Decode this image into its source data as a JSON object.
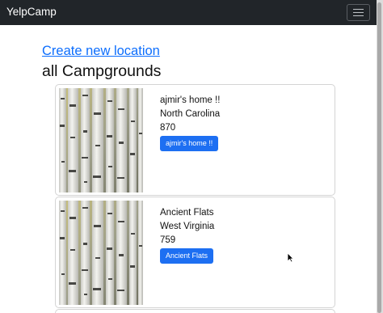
{
  "navbar": {
    "brand": "YelpCamp",
    "menu_icon": "hamburger-icon"
  },
  "main": {
    "create_link": "Create new location",
    "title": "all Campgrounds",
    "campgrounds": [
      {
        "name": "ajmir's home !!",
        "location": "North Carolina",
        "price": "870",
        "button_label": "ajmir's home !!",
        "image": "birch-trees-image"
      },
      {
        "name": "Ancient Flats",
        "location": "West Virginia",
        "price": "759",
        "button_label": "Ancient Flats",
        "image": "birch-trees-image"
      }
    ]
  },
  "colors": {
    "navbar": "#212529",
    "link": "#0d6efd",
    "button": "#1d6ff2"
  }
}
